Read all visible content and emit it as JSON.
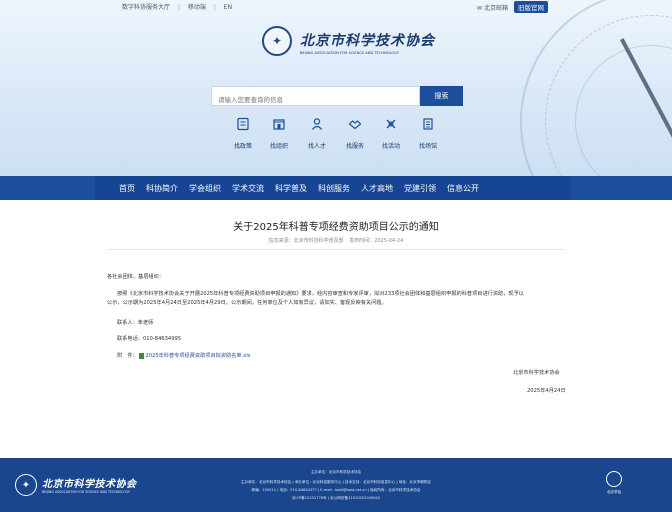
{
  "topbar": {
    "left_links": [
      "数字科协服务大厅",
      "|",
      "移动端",
      "|",
      "EN"
    ],
    "mail_label": "北京邮箱",
    "old_site_label": "旧版官网"
  },
  "header": {
    "org_name_cn": "北京市科学技术协会",
    "org_name_en": "BEIJING ASSOCIATION FOR SCIENCE AND TECHNOLOGY"
  },
  "search": {
    "placeholder": "请输入您要查询的信息",
    "button_label": "搜索"
  },
  "quick_links": [
    {
      "label": "找政策",
      "icon": "document-icon"
    },
    {
      "label": "找组织",
      "icon": "building-icon"
    },
    {
      "label": "找人才",
      "icon": "person-icon"
    },
    {
      "label": "找服务",
      "icon": "handshake-icon"
    },
    {
      "label": "找活动",
      "icon": "activity-icon"
    },
    {
      "label": "找场馆",
      "icon": "venue-icon"
    }
  ],
  "nav": {
    "items": [
      "首页",
      "科协简介",
      "学会组织",
      "学术交流",
      "科学普及",
      "科创服务",
      "人才高地",
      "党建引领",
      "信息公开"
    ]
  },
  "article": {
    "title": "关于2025年科普专项经费资助项目公示的通知",
    "meta_source": "信息来源：北京市科协科学普及部",
    "meta_date": "发布时间：2025-04-24",
    "greeting": "各社会团体、基层组织：",
    "body_line1": "按照《北京市科学技术协会关于开展2025年科普专项经费资助项目申报的通知》要求，经内容审查和专家评审，拟对233项社会团体和基层组织申报的科普项目进行资助，",
    "body_line1_end": "现予以",
    "body_line2": "公示，公示期为2025年4月24日至2025年4月29日。公示期间，任何单位及个人如有异议，请如实、客观反映有关问题。",
    "contact_person": "联系人：朱老师",
    "contact_phone": "联系电话：010-84634995",
    "attachment_label": "附　件：",
    "attachment_name": "2025年科普专项经费资助项目拟资助名单.xls",
    "signature": "北京市科学技术协会",
    "sign_date": "2025年4月24日"
  },
  "footer": {
    "org_name_cn": "北京市科学技术协会",
    "org_name_en": "BEIJING ASSOCIATION FOR SCIENCE AND TECHNOLOGY",
    "line1": "主办单位：北京市科学技术协会",
    "line2": "主办单位：北京市科学技术协会 | 承办单位：北京科技服务中心 | 技术支持：北京市科协信息中心 | 地址：北京市朝阳区",
    "line3": "邮编：100011 | 电话：010-84634377 | E-mail：bast@bast.net.cn | 版权所有：北京市科学技术协会",
    "line4": "京ICP备12231776号 | 京公网安备11010502040042",
    "badge_label": "北京学会"
  },
  "colors": {
    "brand_blue": "#1d4e9c",
    "nav_blue": "#164593",
    "footer_blue": "#19468d"
  }
}
